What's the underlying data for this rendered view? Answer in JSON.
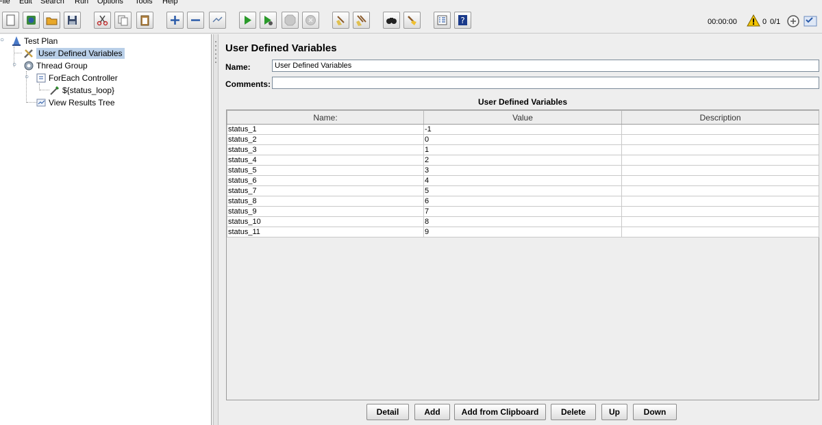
{
  "menu": [
    "File",
    "Edit",
    "Search",
    "Run",
    "Options",
    "Tools",
    "Help"
  ],
  "toolbar": {
    "buttons": [
      "new-icon",
      "templates-icon",
      "open-icon",
      "save-icon",
      "cut-icon",
      "copy-icon",
      "paste-icon",
      "expand-icon",
      "collapse-icon",
      "toggle-icon",
      "start-icon",
      "start-no-pauses-icon",
      "stop-icon",
      "shutdown-icon",
      "clear-icon",
      "clear-all-icon",
      "search-icon",
      "reset-search-icon",
      "function-helper-icon",
      "help-icon"
    ],
    "timer": "00:00:00",
    "error_count": "0",
    "threads": "0/1"
  },
  "tree": {
    "items": [
      {
        "label": "Test Plan",
        "icon": "test-plan-icon"
      },
      {
        "label": "User Defined Variables",
        "icon": "variables-tools-icon",
        "selected": true
      },
      {
        "label": "Thread Group",
        "icon": "thread-group-gear-icon"
      },
      {
        "label": "ForEach Controller",
        "icon": "controller-icon"
      },
      {
        "label": "${status_loop}",
        "icon": "sampler-pipette-icon"
      },
      {
        "label": "View Results Tree",
        "icon": "listener-icon"
      }
    ]
  },
  "panel": {
    "title": "User Defined Variables",
    "name_label": "Name:",
    "name_value": "User Defined Variables",
    "comments_label": "Comments:",
    "comments_value": "",
    "table_title": "User Defined Variables",
    "columns": [
      "Name:",
      "Value",
      "Description"
    ],
    "rows": [
      [
        "status_1",
        "-1",
        ""
      ],
      [
        "status_2",
        "0",
        ""
      ],
      [
        "status_3",
        "1",
        ""
      ],
      [
        "status_4",
        "2",
        ""
      ],
      [
        "status_5",
        "3",
        ""
      ],
      [
        "status_6",
        "4",
        ""
      ],
      [
        "status_7",
        "5",
        ""
      ],
      [
        "status_8",
        "6",
        ""
      ],
      [
        "status_9",
        "7",
        ""
      ],
      [
        "status_10",
        "8",
        ""
      ],
      [
        "status_11",
        "9",
        ""
      ]
    ],
    "buttons": [
      "Detail",
      "Add",
      "Add from Clipboard",
      "Delete",
      "Up",
      "Down"
    ]
  },
  "colors": {
    "selection": "#b9cfe8",
    "run_green": "#2a9a2a",
    "warning": "#f2c400"
  }
}
